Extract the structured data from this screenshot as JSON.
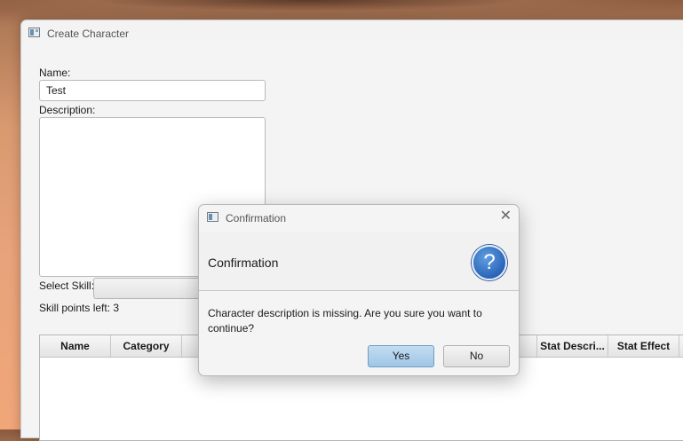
{
  "main_window": {
    "title": "Create Character",
    "close_glyph": "✕",
    "name_label": "Name:",
    "name_value": "Test",
    "description_label": "Description:",
    "description_value": "",
    "select_skill_label": "Select Skill:",
    "select_skill_value": "",
    "skill_points_label": "Skill points left: 3",
    "table": {
      "columns": [
        "Name",
        "Category",
        "Stat Descri...",
        "Stat Effect"
      ]
    }
  },
  "dialog": {
    "title": "Confirmation",
    "close_glyph": "✕",
    "header": "Confirmation",
    "icon": "question-icon",
    "icon_glyph": "?",
    "message": "Character description is missing. Are you sure you want to continue?",
    "yes_label": "Yes",
    "no_label": "No"
  },
  "colors": {
    "accent_button": "#9fc6e6",
    "question_icon": "#2a64b8"
  }
}
